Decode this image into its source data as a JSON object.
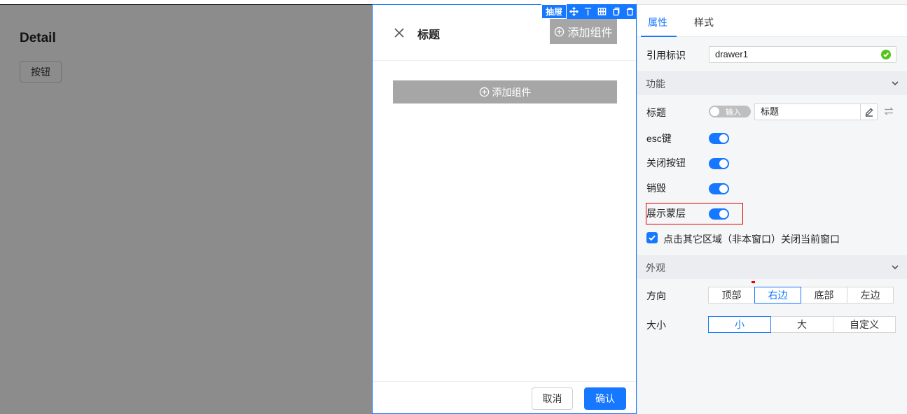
{
  "canvas": {
    "page_title": "Detail",
    "page_button": "按钮"
  },
  "drawer": {
    "tag": "抽屉",
    "toolbar_icons": [
      "move-icon",
      "align-top-icon",
      "grid-icon",
      "copy-icon",
      "delete-icon"
    ],
    "title": "标题",
    "header_add_label": "添加组件",
    "body_add_label": "添加组件",
    "cancel_label": "取消",
    "confirm_label": "确认"
  },
  "panel": {
    "tabs": [
      "属性",
      "样式"
    ],
    "active_tab": "属性",
    "ref_label": "引用标识",
    "ref_value": "drawer1",
    "sections": {
      "function": "功能",
      "appearance": "外观"
    },
    "title_row": {
      "label": "标题",
      "mode_toggle": "输入",
      "value": "标题"
    },
    "switches": [
      {
        "label": "esc键",
        "on": true
      },
      {
        "label": "关闭按钮",
        "on": true
      },
      {
        "label": "销毁",
        "on": true
      },
      {
        "label": "展示蒙层",
        "on": true
      }
    ],
    "overlay_close_checkbox": {
      "label": "点击其它区域（非本窗口）关闭当前窗口",
      "checked": true
    },
    "direction": {
      "label": "方向",
      "options": [
        "顶部",
        "右边",
        "底部",
        "左边"
      ],
      "selected": "右边"
    },
    "size": {
      "label": "大小",
      "options": [
        "小",
        "大",
        "自定义"
      ],
      "selected": "小"
    }
  },
  "colors": {
    "accent": "#1677ff",
    "highlight": "#dd0000",
    "success": "#52c41a"
  }
}
